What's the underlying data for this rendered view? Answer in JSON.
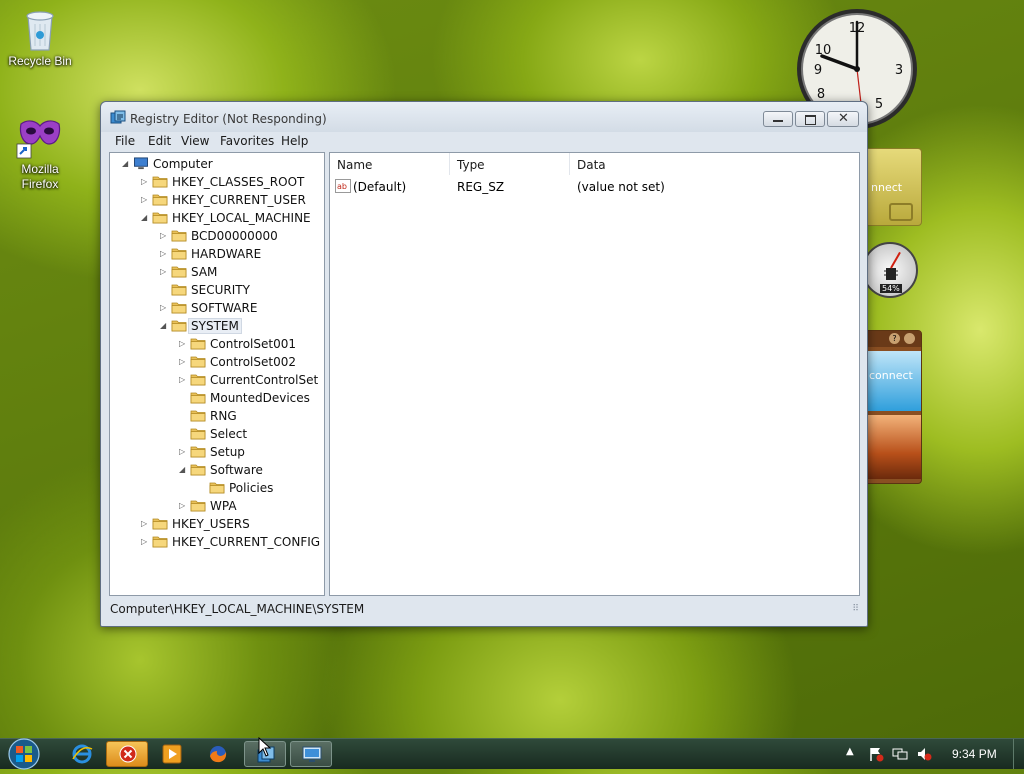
{
  "desktop": {
    "icons": [
      {
        "name": "recycle-bin",
        "label": "Recycle Bin"
      },
      {
        "name": "mozilla-firefox",
        "label": "Mozilla Firefox"
      }
    ]
  },
  "gadgets": {
    "clock": {
      "time": "9:34"
    },
    "cpu_meter": {
      "percent_label": "54%"
    },
    "news_card": {
      "text": "nnect"
    },
    "slideshow_card": {
      "text": "connect"
    }
  },
  "window": {
    "title": "Registry Editor (Not Responding)",
    "menu": [
      "File",
      "Edit",
      "View",
      "Favorites",
      "Help"
    ],
    "tree": [
      {
        "label": "Computer",
        "depth": 0,
        "expander": "open",
        "icon": "computer-icon"
      },
      {
        "label": "HKEY_CLASSES_ROOT",
        "depth": 1,
        "expander": "closed"
      },
      {
        "label": "HKEY_CURRENT_USER",
        "depth": 1,
        "expander": "closed"
      },
      {
        "label": "HKEY_LOCAL_MACHINE",
        "depth": 1,
        "expander": "open"
      },
      {
        "label": "BCD00000000",
        "depth": 2,
        "expander": "closed"
      },
      {
        "label": "HARDWARE",
        "depth": 2,
        "expander": "closed"
      },
      {
        "label": "SAM",
        "depth": 2,
        "expander": "closed"
      },
      {
        "label": "SECURITY",
        "depth": 2,
        "expander": "none"
      },
      {
        "label": "SOFTWARE",
        "depth": 2,
        "expander": "closed"
      },
      {
        "label": "SYSTEM",
        "depth": 2,
        "expander": "open",
        "selected": true
      },
      {
        "label": "ControlSet001",
        "depth": 3,
        "expander": "closed"
      },
      {
        "label": "ControlSet002",
        "depth": 3,
        "expander": "closed"
      },
      {
        "label": "CurrentControlSet",
        "depth": 3,
        "expander": "closed"
      },
      {
        "label": "MountedDevices",
        "depth": 3,
        "expander": "none"
      },
      {
        "label": "RNG",
        "depth": 3,
        "expander": "none"
      },
      {
        "label": "Select",
        "depth": 3,
        "expander": "none"
      },
      {
        "label": "Setup",
        "depth": 3,
        "expander": "closed"
      },
      {
        "label": "Software",
        "depth": 3,
        "expander": "open"
      },
      {
        "label": "Policies",
        "depth": 4,
        "expander": "none"
      },
      {
        "label": "WPA",
        "depth": 3,
        "expander": "closed"
      },
      {
        "label": "HKEY_USERS",
        "depth": 1,
        "expander": "closed"
      },
      {
        "label": "HKEY_CURRENT_CONFIG",
        "depth": 1,
        "expander": "closed"
      }
    ],
    "columns": [
      "Name",
      "Type",
      "Data"
    ],
    "values": [
      {
        "name": "(Default)",
        "type": "REG_SZ",
        "data": "(value not set)",
        "icon": "string-value-icon"
      }
    ],
    "status": "Computer\\HKEY_LOCAL_MACHINE\\SYSTEM"
  },
  "taskbar": {
    "buttons": [
      "start",
      "internet-explorer",
      "alert-app",
      "media-player",
      "firefox",
      "registry-editor",
      "remote-desktop"
    ],
    "clock": "9:34 PM"
  }
}
